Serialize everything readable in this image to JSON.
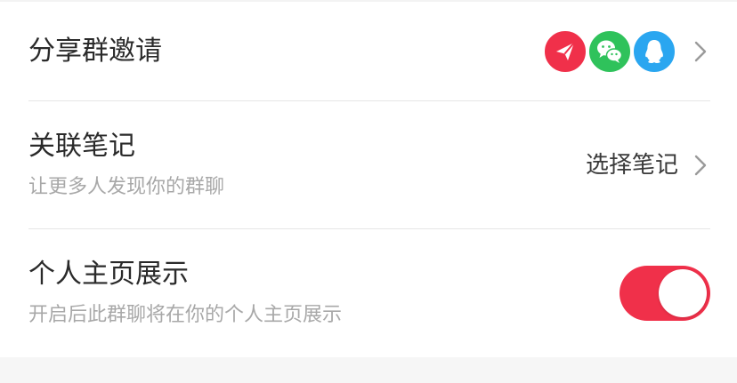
{
  "share_row": {
    "title": "分享群邀请",
    "icons": [
      "paper-plane-icon",
      "wechat-icon",
      "qq-icon"
    ]
  },
  "link_note_row": {
    "title": "关联笔记",
    "subtitle": "让更多人发现你的群聊",
    "action": "选择笔记"
  },
  "home_display_row": {
    "title": "个人主页展示",
    "subtitle": "开启后此群聊将在你的个人主页展示",
    "enabled": true
  },
  "colors": {
    "accent": "#f0304a",
    "wechat": "#2fc25b",
    "qq": "#2aa6f0",
    "title_text": "#2a2a2a",
    "subtitle_text": "#a8a8a8",
    "divider": "#e6e6e6"
  }
}
